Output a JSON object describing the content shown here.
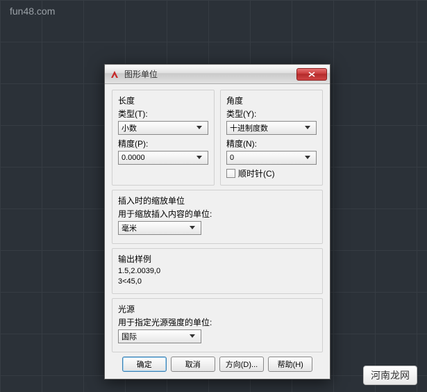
{
  "watermark": "fun48.com",
  "badge": "河南龙网",
  "dialog": {
    "title": "图形单位",
    "length": {
      "group_label": "长度",
      "type_label": "类型(T):",
      "type_value": "小数",
      "precision_label": "精度(P):",
      "precision_value": "0.0000"
    },
    "angle": {
      "group_label": "角度",
      "type_label": "类型(Y):",
      "type_value": "十进制度数",
      "precision_label": "精度(N):",
      "precision_value": "0",
      "clockwise_label": "顺时针(C)"
    },
    "insertion": {
      "group_label": "插入时的缩放单位",
      "desc": "用于缩放插入内容的单位:",
      "value": "毫米"
    },
    "sample": {
      "group_label": "输出样例",
      "line1": "1.5,2.0039,0",
      "line2": "3<45,0"
    },
    "lighting": {
      "group_label": "光源",
      "desc": "用于指定光源强度的单位:",
      "value": "国际"
    },
    "buttons": {
      "ok": "确定",
      "cancel": "取消",
      "direction": "方向(D)...",
      "help": "帮助(H)"
    }
  }
}
